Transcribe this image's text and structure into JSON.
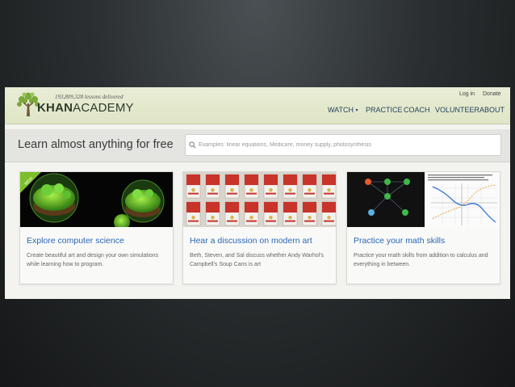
{
  "header": {
    "lessons_count": "193,809,328 lessons delivered",
    "logo_bold": "KHAN",
    "logo_rest": "ACADEMY",
    "login_label": "Log in",
    "donate_label": "Donate",
    "nav": [
      {
        "label": "WATCH",
        "has_dropdown": true
      },
      {
        "label": "PRACTICE"
      },
      {
        "label": "COACH"
      },
      {
        "label": "VOLUNTEER"
      },
      {
        "label": "ABOUT"
      }
    ]
  },
  "hero": {
    "headline": "Learn almost anything for free",
    "search_placeholder": "Examples: linear equations, Medicare, money supply, photosynthesis"
  },
  "cards": [
    {
      "title": "Explore computer science",
      "description": "Create beautiful art and design your own simulations while learning how to program.",
      "thumb_badge": "NEW",
      "thumbnail": "green-planets"
    },
    {
      "title": "Hear a discussion on modern art",
      "description": "Beth, Steven, and Sal discuss whether Andy Warhol's Campbell's Soup Cans is art",
      "thumbnail": "soup-cans"
    },
    {
      "title": "Practice your math skills",
      "description": "Practice your math skills from addition to calculus and everything in between.",
      "thumbnail": "knowledge-map-graph"
    }
  ],
  "colors": {
    "header_bg": "#e5eacf",
    "link_blue": "#2a68b3",
    "nav_text": "#26405e",
    "logo_green": "#6a9a2e"
  }
}
